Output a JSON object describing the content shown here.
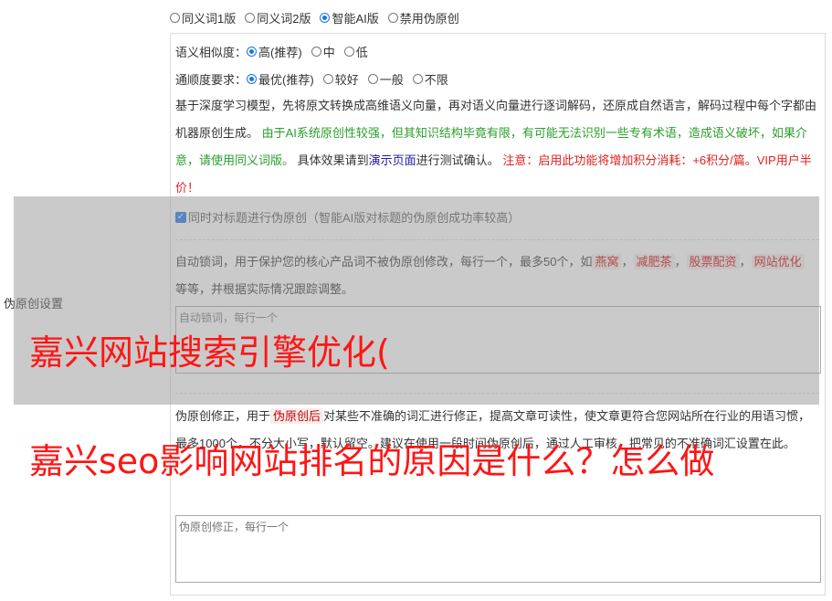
{
  "mode_options": [
    {
      "label": "同义词1版",
      "selected": false
    },
    {
      "label": "同义词2版",
      "selected": false
    },
    {
      "label": "智能AI版",
      "selected": true
    },
    {
      "label": "禁用伪原创",
      "selected": false
    }
  ],
  "similarity": {
    "label": "语义相似度：",
    "options": [
      {
        "label": "高(推荐)",
        "selected": true
      },
      {
        "label": "中",
        "selected": false
      },
      {
        "label": "低",
        "selected": false
      }
    ]
  },
  "fluency": {
    "label": "通顺度要求：",
    "options": [
      {
        "label": "最优(推荐)",
        "selected": true
      },
      {
        "label": "较好",
        "selected": false
      },
      {
        "label": "一般",
        "selected": false
      },
      {
        "label": "不限",
        "selected": false
      }
    ]
  },
  "desc": {
    "p1": "基于深度学习模型，先将原文转换成高维语义向量，再对语义向量进行逐词解码，还原成自然语言，解码过程中每个字都由机器原创生成。",
    "p2": "由于AI系统原创性较强，但其知识结构毕竟有限，有可能无法识别一些专有术语，造成语义破坏，如果介意，请使用同义词版。",
    "p3": "具体效果请到",
    "link": "演示页面",
    "p4": "进行测试确认。",
    "warn": "注意：启用此功能将增加积分消耗：+6积分/篇。VIP用户半价！"
  },
  "title_checkbox": {
    "label": "同时对标题进行伪原创（智能AI版对标题的伪原创成功率较高）",
    "checked": true
  },
  "side_label": "伪原创设置",
  "lock": {
    "text1": "自动锁词，用于保护您的核心产品词不被伪原创修改，每行一个，最多50个，如",
    "examples": [
      "燕窝",
      "减肥茶",
      "股票配资",
      "网站优化"
    ],
    "text2": "等等，并根据实际情况跟踪调整。",
    "placeholder": "自动锁词，每行一个"
  },
  "fix": {
    "text1": "伪原创修正，用于",
    "chip": "伪原创后",
    "text2": "对某些不准确的词汇进行修正，提高文章可读性，使文章更符合您网站所在行业的用语习惯，",
    "text3": "最多1000个，不分大小写，默认留空。建议在使用一段时间伪原创后，通过人工审核，把常见的不准确词汇设置在此。",
    "placeholder": "伪原创修正，每行一个"
  },
  "overlay_titles": {
    "line1": "嘉兴网站搜索引擎优化(",
    "line2": "嘉兴seo影响网站排名的原因是什么？怎么做"
  }
}
